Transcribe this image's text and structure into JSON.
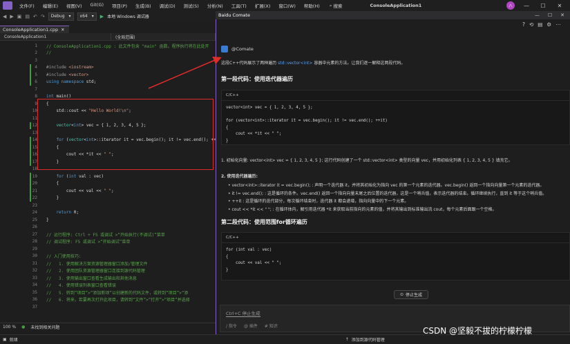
{
  "menu": {
    "items": [
      "文件(F)",
      "编辑(E)",
      "视图(V)",
      "Git(G)",
      "项目(P)",
      "生成(B)",
      "调试(D)",
      "测试(S)",
      "分析(N)",
      "工具(T)",
      "扩展(X)",
      "窗口(W)",
      "帮助(H)"
    ],
    "search": "搜索",
    "title": "ConsoleApplication1",
    "avatar": "八"
  },
  "toolbar": {
    "config": "Debug",
    "platform": "x64",
    "run_label": "本地 Windows 调试器"
  },
  "editor": {
    "tab": "ConsoleApplication1.cpp",
    "nav_project": "ConsoleApplication1",
    "nav_scope": "(全局范围)",
    "lines": [
      {
        "n": "1",
        "segs": [
          [
            "c-com",
            "// ConsoleApplication1.cpp : 此文件包含 \"main\" 函数。程序执行将在此处开"
          ]
        ]
      },
      {
        "n": "2",
        "segs": [
          [
            "c-com",
            "//"
          ]
        ]
      },
      {
        "n": "3",
        "segs": []
      },
      {
        "n": "4",
        "segs": [
          [
            "c-pre",
            "#include "
          ],
          [
            "c-str",
            "<iostream>"
          ]
        ]
      },
      {
        "n": "5",
        "segs": [
          [
            "c-pre",
            "#include "
          ],
          [
            "c-str",
            "<vector>"
          ]
        ]
      },
      {
        "n": "6",
        "segs": [
          [
            "c-kw",
            "using namespace "
          ],
          [
            "c-txt",
            "std;"
          ]
        ]
      },
      {
        "n": "7",
        "segs": []
      },
      {
        "n": "8",
        "segs": [
          [
            "c-kw",
            "int "
          ],
          [
            "c-txt",
            "main()"
          ]
        ]
      },
      {
        "n": "9",
        "segs": [
          [
            "c-txt",
            "{"
          ]
        ]
      },
      {
        "n": "10",
        "segs": [
          [
            "c-txt",
            "    std::cout << "
          ],
          [
            "c-str",
            "\"Hello World!\\n\""
          ],
          [
            "c-txt",
            ";"
          ]
        ]
      },
      {
        "n": "11",
        "segs": []
      },
      {
        "n": "12",
        "segs": [
          [
            "c-typ",
            "    vector"
          ],
          [
            "c-txt",
            "<"
          ],
          [
            "c-kw",
            "int"
          ],
          [
            "c-txt",
            "> vec = { 1, 2, 3, 4, 5 };"
          ]
        ]
      },
      {
        "n": "13",
        "segs": []
      },
      {
        "n": "14",
        "segs": [
          [
            "c-kw",
            "    for "
          ],
          [
            "c-txt",
            "("
          ],
          [
            "c-typ",
            "vector"
          ],
          [
            "c-txt",
            "<"
          ],
          [
            "c-kw",
            "int"
          ],
          [
            "c-txt",
            ">::iterator it = vec.begin(); it != vec.end(); ++it"
          ]
        ]
      },
      {
        "n": "15",
        "segs": [
          [
            "c-txt",
            "    {"
          ]
        ]
      },
      {
        "n": "16",
        "segs": [
          [
            "c-txt",
            "        cout << *it << "
          ],
          [
            "c-str",
            "\" \""
          ],
          [
            "c-txt",
            ";"
          ]
        ]
      },
      {
        "n": "17",
        "segs": [
          [
            "c-txt",
            "    }"
          ]
        ]
      },
      {
        "n": "18",
        "segs": []
      },
      {
        "n": "19",
        "segs": [
          [
            "c-kw",
            "    for "
          ],
          [
            "c-txt",
            "("
          ],
          [
            "c-kw",
            "int "
          ],
          [
            "c-txt",
            "val : vec)"
          ]
        ]
      },
      {
        "n": "20",
        "segs": [
          [
            "c-txt",
            "    {"
          ]
        ]
      },
      {
        "n": "21",
        "segs": [
          [
            "c-txt",
            "        cout << val << "
          ],
          [
            "c-str",
            "\" \""
          ],
          [
            "c-txt",
            ";"
          ]
        ]
      },
      {
        "n": "22",
        "segs": [
          [
            "c-txt",
            "    }"
          ]
        ]
      },
      {
        "n": "23",
        "segs": []
      },
      {
        "n": "24",
        "segs": [
          [
            "c-kw",
            "    return "
          ],
          [
            "c-txt",
            "0;"
          ]
        ]
      },
      {
        "n": "25",
        "segs": [
          [
            "c-txt",
            "}"
          ]
        ]
      },
      {
        "n": "26",
        "segs": []
      },
      {
        "n": "27",
        "segs": [
          [
            "c-com",
            "// 运行程序: Ctrl + F5 或调试 >“开始执行(不调试)”菜单"
          ]
        ]
      },
      {
        "n": "28",
        "segs": [
          [
            "c-com",
            "// 调试程序: F5 或调试 >“开始调试”菜单"
          ]
        ]
      },
      {
        "n": "29",
        "segs": []
      },
      {
        "n": "30",
        "segs": [
          [
            "c-com",
            "// 入门使用技巧:"
          ]
        ]
      },
      {
        "n": "31",
        "segs": [
          [
            "c-com",
            "//   1. 使用解决方案资源管理器窗口添加/管理文件"
          ]
        ]
      },
      {
        "n": "32",
        "segs": [
          [
            "c-com",
            "//   2. 使用团队资源管理器窗口连接到源代码管理"
          ]
        ]
      },
      {
        "n": "33",
        "segs": [
          [
            "c-com",
            "//   3. 使用输出窗口查看生成输出和其他消息"
          ]
        ]
      },
      {
        "n": "34",
        "segs": [
          [
            "c-com",
            "//   4. 使用错误列表窗口查看错误"
          ]
        ]
      },
      {
        "n": "35",
        "segs": [
          [
            "c-com",
            "//   5. 转到“项目”>“添加新项”以创建新的代码文件，或转到“项目”>“添"
          ]
        ]
      },
      {
        "n": "36",
        "segs": [
          [
            "c-com",
            "//   6. 将来，若要再次打开此项目，请转到“文件”>“打开”>“项目”并选择"
          ]
        ]
      },
      {
        "n": "37",
        "segs": []
      }
    ],
    "zoom": "100 %",
    "issues": "未找到相关问题"
  },
  "status": {
    "ready": "就绪",
    "source_control": "添加到源代码管理"
  },
  "comate": {
    "window_title": "Baidu Comate",
    "author": "@Comate",
    "intro_a": "这段C++代码展示了两种遍历 ",
    "intro_hl": "std::vector<int>",
    "intro_b": " 容器中元素的方法。让我们逐一解释这两段代码。",
    "h1": "第一段代码：使用迭代器遍历",
    "lang1": "C/C++",
    "code1": [
      "vector<int> vec = { 1, 2, 3, 4, 5 };",
      "",
      "for (vector<int>::iterator it = vec.begin(); it != vec.end(); ++it)",
      "{",
      "    cout << *it << \" \";",
      "}"
    ],
    "p1": "1. 初始化向量:  vector<int> vec = { 1, 2, 3, 4, 5 }; 这行代码创建了一个 std::vector<int> 类型的向量 vec，并用初始化列表 { 1, 2, 3, 4, 5 } 填充它。",
    "p2": "2. 使用迭代器遍历:",
    "bullets": [
      "vector<int>::iterator it = vec.begin(); : 声明一个迭代器 it，并将其初始化为指向 vec 的第一个元素的迭代器。vec.begin() 返回一个指向向量第一个元素的迭代器。",
      "it != vec.end(); : 这是循环的条件。vec.end() 返回一个指向向量末尾之后位置的迭代器，这是一个哨兵值，表示迭代器的结束。循环继续执行，直到 it 等于这个哨兵值。",
      "++it : 这是循环的迭代部分，每次循环结束时，迭代器 it 都会递增，指向向量中的下一个元素。",
      "cout << *it << \" \"; : 在循环体内，解引用迭代器 *it 来获取当前指向的元素的值，并将其输出到标准输出流 cout，每个元素后面跟一个空格。"
    ],
    "h2": "第二段代码：使用范围for循环遍历",
    "lang2": "C/C++",
    "code2": [
      "for (int val : vec)",
      "{",
      "    cout << val << \" \";",
      "}"
    ],
    "stop": "停止生成",
    "input_hint": "Ctrl+C 停止生成",
    "tools": [
      "/ 指令",
      "@ 插件",
      "# 知识"
    ]
  },
  "watermark": "CSDN @坚毅不拔的柠檬柠檬"
}
